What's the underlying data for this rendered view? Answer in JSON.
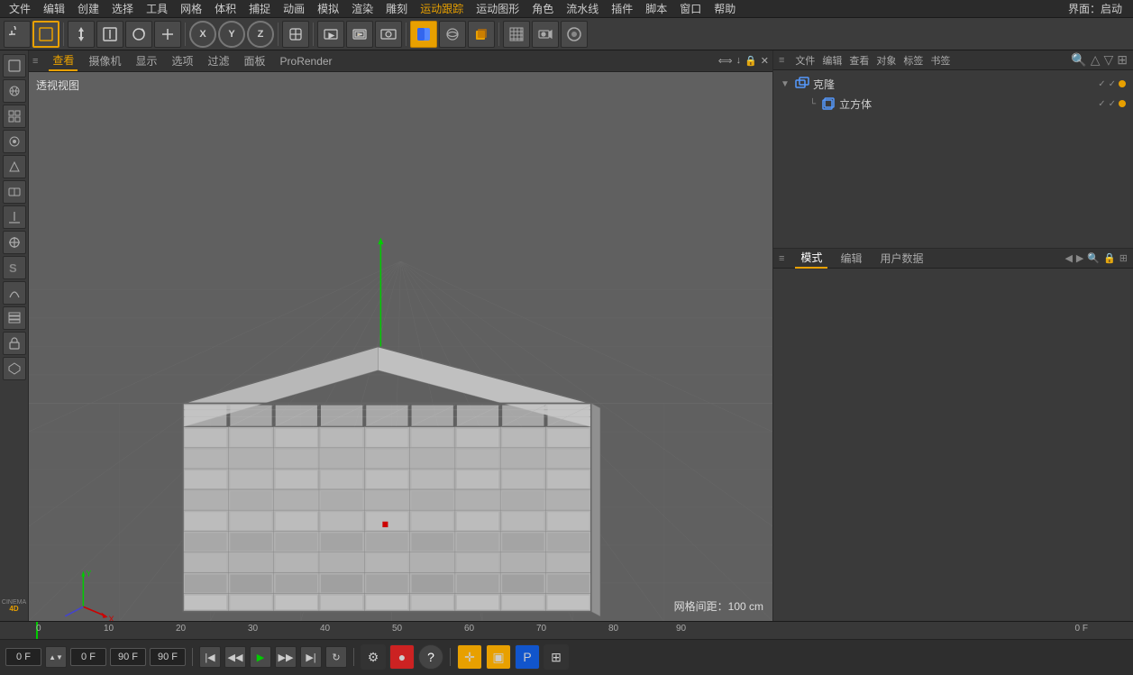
{
  "app": {
    "title": "Cinema 4D",
    "env_label": "界面：",
    "env_value": "启动"
  },
  "top_menu": {
    "items": [
      "文件",
      "编辑",
      "创建",
      "选择",
      "工具",
      "网格",
      "体积",
      "捕捉",
      "动画",
      "模拟",
      "渲染",
      "雕刻",
      "运动跟踪",
      "运动图形",
      "角色",
      "流水线",
      "插件",
      "脚本",
      "窗口",
      "帮助"
    ]
  },
  "toolbar": {
    "undo_label": "↺",
    "tools": [
      "↺",
      "□",
      "✛",
      "⊞",
      "↻",
      "✛",
      "X",
      "Y",
      "Z",
      "◈",
      "▶",
      "⊕",
      "⊡",
      "⊞",
      "▶",
      "●",
      "⊕",
      "◉",
      "◆",
      "■",
      "◉",
      "⊕",
      "◯",
      "▦",
      "◎",
      "●"
    ]
  },
  "viewport": {
    "label": "透视视图",
    "grid_info": "网格间距：100 cm",
    "tabs": [
      "查看",
      "摄像机",
      "显示",
      "选项",
      "过滤",
      "面板",
      "ProRender"
    ]
  },
  "right_panel": {
    "header_btns": [
      "文件",
      "编辑",
      "查看",
      "对象",
      "标签",
      "书签"
    ],
    "objects": [
      {
        "name": "克隆",
        "icon": "clone",
        "indent": 0,
        "expand": true,
        "selected": false,
        "status_green": true,
        "status_check": true
      },
      {
        "name": "立方体",
        "icon": "cube",
        "indent": 1,
        "expand": false,
        "selected": false,
        "status_green": true,
        "status_check": true,
        "has_dot": true
      }
    ],
    "bottom_tabs": [
      "模式",
      "编辑",
      "用户数据"
    ]
  },
  "timeline": {
    "frame_start": "0 F",
    "frame_current": "0 F",
    "frame_end_input": "90 F",
    "frame_end2": "90 F",
    "frame_total": "0 F",
    "markers": [
      "0",
      "10",
      "20",
      "30",
      "40",
      "50",
      "60",
      "70",
      "80",
      "90"
    ],
    "right_frame": "0 F"
  }
}
